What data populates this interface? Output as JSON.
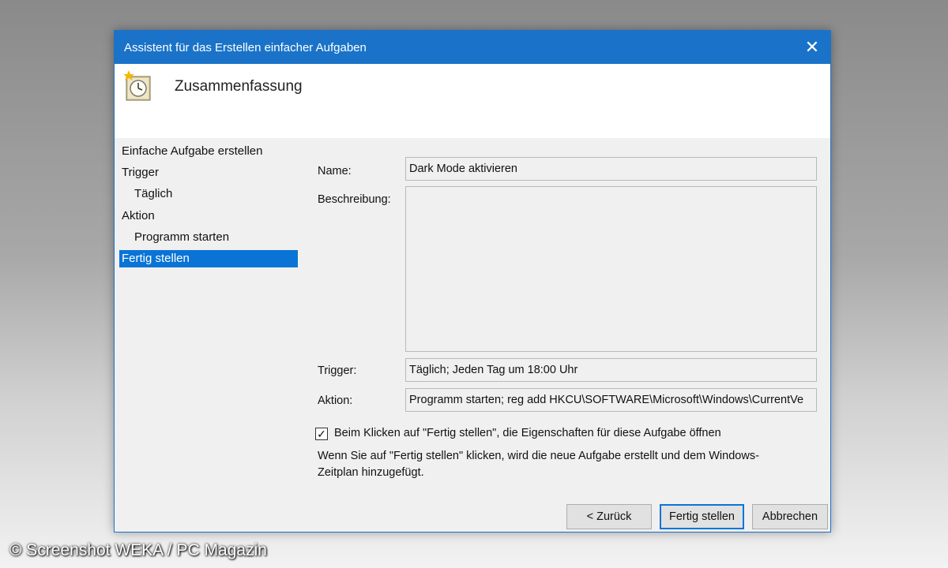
{
  "window": {
    "title": "Assistent für das Erstellen einfacher Aufgaben",
    "close_glyph": "✕"
  },
  "header": {
    "icon": "task-scheduler-clock-icon",
    "title": "Zusammenfassung"
  },
  "sidebar": {
    "items": [
      {
        "label": "Einfache Aufgabe erstellen",
        "level": 0,
        "active": false
      },
      {
        "label": "Trigger",
        "level": 0,
        "active": false
      },
      {
        "label": "Täglich",
        "level": 1,
        "active": false
      },
      {
        "label": "Aktion",
        "level": 0,
        "active": false
      },
      {
        "label": "Programm starten",
        "level": 1,
        "active": false
      },
      {
        "label": "Fertig stellen",
        "level": 0,
        "active": true
      }
    ]
  },
  "summary": {
    "name_label": "Name:",
    "name_value": "Dark Mode aktivieren",
    "description_label": "Beschreibung:",
    "description_value": "",
    "trigger_label": "Trigger:",
    "trigger_value": "Täglich; Jeden Tag um 18:00 Uhr",
    "action_label": "Aktion:",
    "action_value": "Programm starten; reg add HKCU\\SOFTWARE\\Microsoft\\Windows\\CurrentVe"
  },
  "options": {
    "open_properties_checked": true,
    "open_properties_label": "Beim Klicken auf \"Fertig stellen\", die Eigenschaften für diese Aufgabe öffnen",
    "info_text": "Wenn Sie auf \"Fertig stellen\" klicken, wird die neue Aufgabe erstellt und dem Windows-Zeitplan hinzugefügt."
  },
  "buttons": {
    "back": "< Zurück",
    "finish": "Fertig stellen",
    "cancel": "Abbrechen"
  },
  "watermark": "© Screenshot WEKA / PC Magazin",
  "colors": {
    "accent": "#1a73c8",
    "selection": "#0a74d6",
    "dialog_bg": "#f0f0f0"
  }
}
